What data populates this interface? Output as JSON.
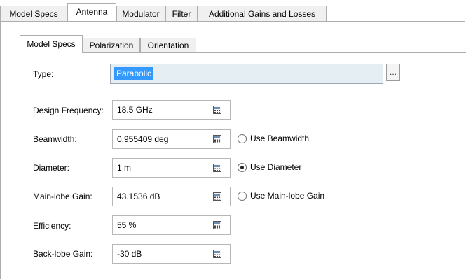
{
  "outer_tabs": [
    {
      "label": "Model Specs",
      "active": false
    },
    {
      "label": "Antenna",
      "active": true
    },
    {
      "label": "Modulator",
      "active": false
    },
    {
      "label": "Filter",
      "active": false
    },
    {
      "label": "Additional Gains and Losses",
      "active": false
    }
  ],
  "inner_tabs": [
    {
      "label": "Model Specs",
      "active": true
    },
    {
      "label": "Polarization",
      "active": false
    },
    {
      "label": "Orientation",
      "active": false
    }
  ],
  "type": {
    "label": "Type:",
    "value": "Parabolic",
    "browse_label": "..."
  },
  "fields": [
    {
      "label": "Design Frequency:",
      "value": "18.5 GHz"
    },
    {
      "label": "Beamwidth:",
      "value": "0.955409 deg"
    },
    {
      "label": "Diameter:",
      "value": "1 m"
    },
    {
      "label": "Main-lobe Gain:",
      "value": "43.1536 dB"
    },
    {
      "label": "Efficiency:",
      "value": "55 %"
    },
    {
      "label": "Back-lobe Gain:",
      "value": "-30 dB"
    }
  ],
  "radios": [
    {
      "label": "Use Beamwidth",
      "checked": false
    },
    {
      "label": "Use Diameter",
      "checked": true
    },
    {
      "label": "Use Main-lobe Gain",
      "checked": false
    }
  ]
}
